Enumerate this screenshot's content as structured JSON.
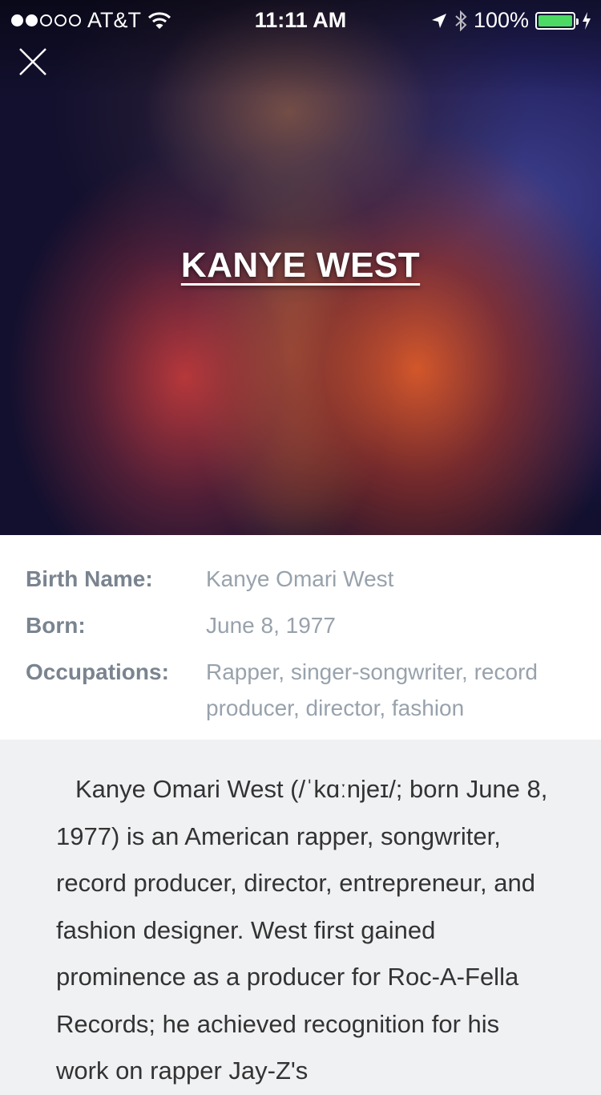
{
  "status_bar": {
    "carrier": "AT&T",
    "time": "11:11 AM",
    "battery": "100%",
    "signal_dots_on": 2,
    "signal_dots_total": 5
  },
  "header": {
    "title": "KANYE WEST",
    "close_icon": "close-icon"
  },
  "details": [
    {
      "label": "Birth Name:",
      "value": "Kanye Omari West"
    },
    {
      "label": "Born:",
      "value": "June 8, 1977"
    },
    {
      "label": "Occupations:",
      "value": "Rapper, singer-songwriter, record producer, director, fashion"
    }
  ],
  "bio": "Kanye Omari West (/ˈkɑːnjeɪ/; born June 8, 1977) is an American rapper, songwriter, record producer, director, entrepreneur, and fashion designer. West first gained prominence as a producer for Roc-A-Fella Records; he achieved recognition for his work on rapper Jay-Z's",
  "colors": {
    "battery_fill": "#4cd964",
    "label": "#7a8490",
    "value": "#98a2ac",
    "bio_bg": "#f0f1f3"
  }
}
